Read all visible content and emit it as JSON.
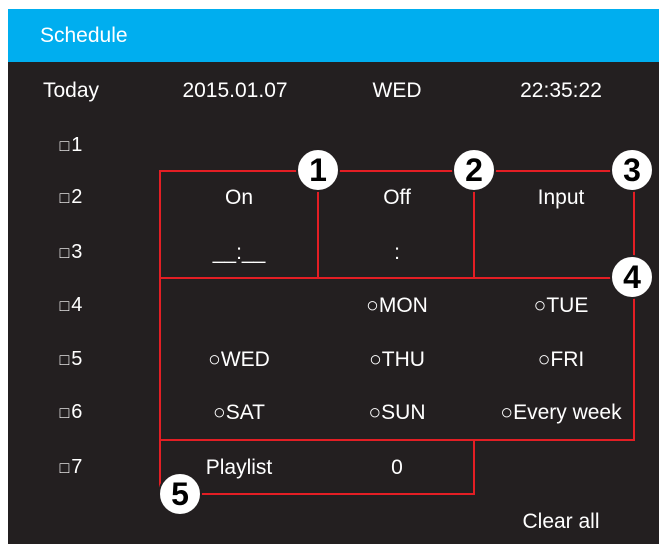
{
  "header": {
    "title": "Schedule"
  },
  "status": {
    "today_label": "Today",
    "date": "2015.01.07",
    "weekday": "WED",
    "time": "22:35:22"
  },
  "schedules": [
    {
      "box": "□",
      "num": "1"
    },
    {
      "box": "□",
      "num": "2"
    },
    {
      "box": "□",
      "num": "3"
    },
    {
      "box": "□",
      "num": "4"
    },
    {
      "box": "□",
      "num": "5"
    },
    {
      "box": "□",
      "num": "6"
    },
    {
      "box": "□",
      "num": "7"
    }
  ],
  "editor": {
    "on_label": "On",
    "off_label": "Off",
    "input_label": "Input",
    "on_time": "__:__",
    "off_time": ":",
    "days": {
      "mon": "○MON",
      "tue": "○TUE",
      "wed": "○WED",
      "thu": "○THU",
      "fri": "○FRI",
      "sat": "○SAT",
      "sun": "○SUN",
      "every_week": "○Every week"
    },
    "playlist_label": "Playlist",
    "playlist_value": "0"
  },
  "clear_all": "Clear all",
  "callouts": [
    "1",
    "2",
    "3",
    "4",
    "5"
  ],
  "colors": {
    "title_bar": "#00aeef",
    "background": "#231f20",
    "callout_border": "#e31e24"
  }
}
